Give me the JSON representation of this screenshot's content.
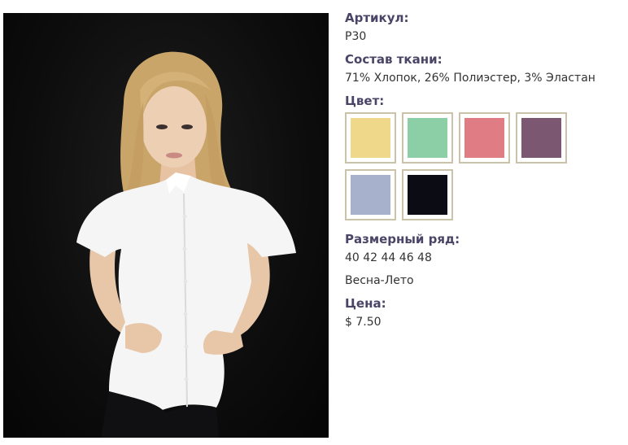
{
  "product": {
    "article_label": "Артикул:",
    "article_value": "Р30",
    "fabric_label": "Состав ткани:",
    "fabric_value": "71% Хлопок, 26% Полиэстер, 3% Эластан",
    "color_label": "Цвет:",
    "colors": [
      {
        "name": "yellow",
        "hex": "#efd88a"
      },
      {
        "name": "mint",
        "hex": "#8ccfa6"
      },
      {
        "name": "pink",
        "hex": "#df7c84"
      },
      {
        "name": "mauve",
        "hex": "#7b5771"
      },
      {
        "name": "lavender-blue",
        "hex": "#a7b1cb"
      },
      {
        "name": "black",
        "hex": "#0b0c14"
      }
    ],
    "sizes_label": "Размерный ряд:",
    "sizes_value": "40 42 44 46 48",
    "season": "Весна-Лето",
    "price_label": "Цена:",
    "price_value": "$ 7.50"
  }
}
